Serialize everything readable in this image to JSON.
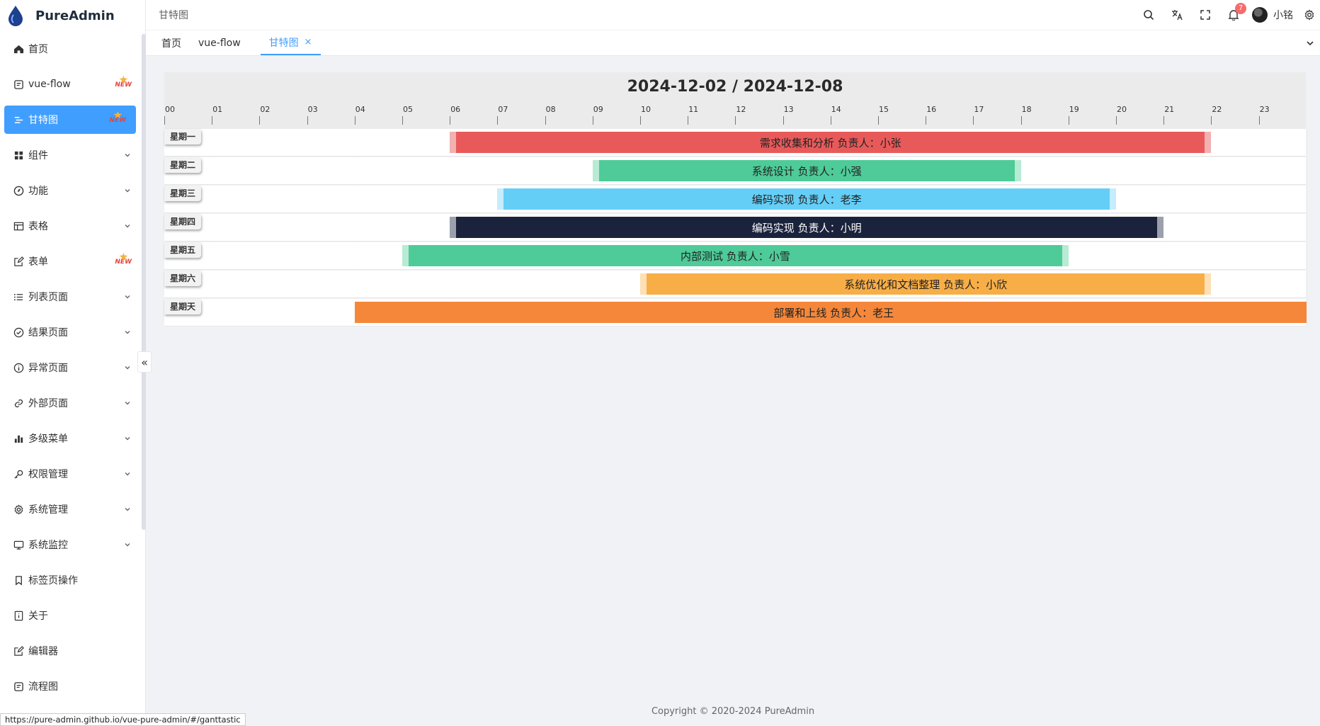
{
  "app": {
    "name": "PureAdmin"
  },
  "header": {
    "breadcrumb": "甘特图",
    "notification_count": "7",
    "username": "小铭"
  },
  "sidebar": {
    "items": [
      {
        "label": "首页",
        "icon": "home-icon",
        "badge": "",
        "chevron": false
      },
      {
        "label": "vue-flow",
        "icon": "flow-icon",
        "badge": "NEW",
        "chevron": false
      },
      {
        "label": "甘特图",
        "icon": "gantt-icon",
        "badge": "NEW",
        "chevron": false,
        "active": true
      },
      {
        "label": "组件",
        "icon": "grid-icon",
        "badge": "",
        "chevron": true
      },
      {
        "label": "功能",
        "icon": "compass-icon",
        "badge": "",
        "chevron": true
      },
      {
        "label": "表格",
        "icon": "table-icon",
        "badge": "",
        "chevron": true
      },
      {
        "label": "表单",
        "icon": "edit-icon",
        "badge": "NEW",
        "chevron": false
      },
      {
        "label": "列表页面",
        "icon": "list-icon",
        "badge": "",
        "chevron": true
      },
      {
        "label": "结果页面",
        "icon": "check-circle-icon",
        "badge": "",
        "chevron": true
      },
      {
        "label": "异常页面",
        "icon": "info-icon",
        "badge": "",
        "chevron": true
      },
      {
        "label": "外部页面",
        "icon": "link-icon",
        "badge": "",
        "chevron": true
      },
      {
        "label": "多级菜单",
        "icon": "bar-chart-icon",
        "badge": "",
        "chevron": true
      },
      {
        "label": "权限管理",
        "icon": "key-icon",
        "badge": "",
        "chevron": true
      },
      {
        "label": "系统管理",
        "icon": "gear-icon",
        "badge": "",
        "chevron": true
      },
      {
        "label": "系统监控",
        "icon": "monitor-icon",
        "badge": "",
        "chevron": true
      },
      {
        "label": "标签页操作",
        "icon": "bookmark-icon",
        "badge": "",
        "chevron": false
      },
      {
        "label": "关于",
        "icon": "about-icon",
        "badge": "",
        "chevron": false
      },
      {
        "label": "编辑器",
        "icon": "editor-icon",
        "badge": "",
        "chevron": false
      },
      {
        "label": "流程图",
        "icon": "flowchart-icon",
        "badge": "",
        "chevron": false
      }
    ]
  },
  "tabs": [
    {
      "label": "首页",
      "active": false
    },
    {
      "label": "vue-flow",
      "active": false
    },
    {
      "label": "甘特图",
      "active": true,
      "close": "×"
    }
  ],
  "gantt": {
    "title": "2024-12-02 / 2024-12-08",
    "hours": [
      "00",
      "01",
      "02",
      "03",
      "04",
      "05",
      "06",
      "07",
      "08",
      "09",
      "10",
      "11",
      "12",
      "13",
      "14",
      "15",
      "16",
      "17",
      "18",
      "19",
      "20",
      "21",
      "22",
      "23"
    ],
    "rows": [
      {
        "label": "星期一",
        "task": "需求收集和分析 负责人：小张",
        "start": 6.0,
        "end": 22.0,
        "color": "#e85a5a",
        "handle": "#f2b1b1"
      },
      {
        "label": "星期二",
        "task": "系统设计 负责人：小强",
        "start": 9.0,
        "end": 18.0,
        "color": "#4ecb98",
        "handle": "#b8ebd4"
      },
      {
        "label": "星期三",
        "task": "编码实现 负责人：老李",
        "start": 7.0,
        "end": 20.0,
        "color": "#64cef7",
        "handle": "#c6edfd"
      },
      {
        "label": "星期四",
        "task": "编码实现 负责人：小明",
        "start": 6.0,
        "end": 21.0,
        "color": "#1b233c",
        "handle": "#9ca0ad"
      },
      {
        "label": "星期五",
        "task": "内部测试 负责人：小雪",
        "start": 5.0,
        "end": 19.0,
        "color": "#4ecb98",
        "handle": "#b8ebd4"
      },
      {
        "label": "星期六",
        "task": "系统优化和文档整理 负责人：小欣",
        "start": 10.0,
        "end": 22.0,
        "color": "#f8ae47",
        "handle": "#fde0b6"
      },
      {
        "label": "星期天",
        "task": "部署和上线 负责人：老王",
        "start": 4.0,
        "end": 24.0,
        "color": "#f4873a",
        "handle": "#f4873a"
      }
    ]
  },
  "footer": {
    "copyright": "Copyright © 2020-2024 PureAdmin"
  },
  "status_bar": {
    "url": "https://pure-admin.github.io/vue-pure-admin/#/ganttastic"
  }
}
